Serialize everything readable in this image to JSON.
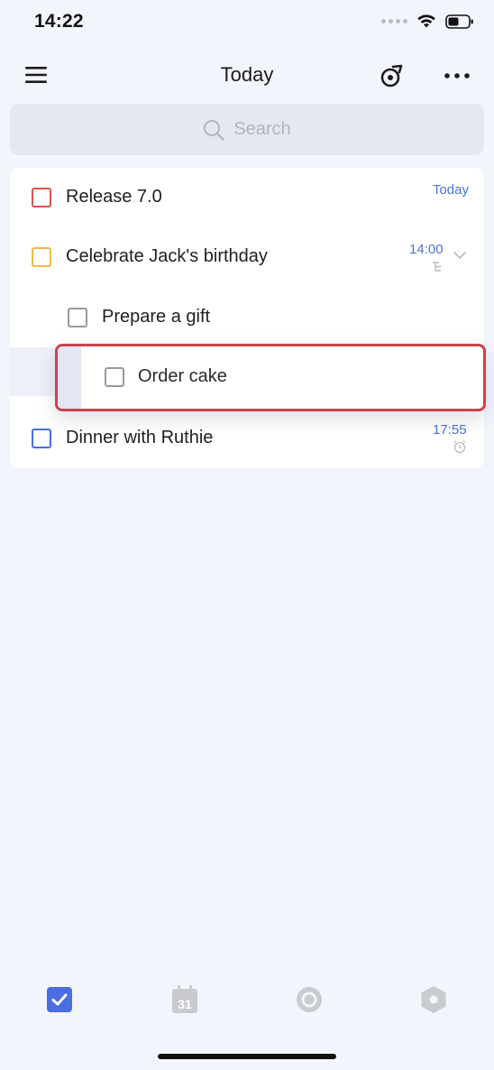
{
  "status_bar": {
    "time": "14:22"
  },
  "header": {
    "title": "Today"
  },
  "search": {
    "placeholder": "Search"
  },
  "tasks": [
    {
      "title": "Release 7.0",
      "date": "Today",
      "priority_color": "#d9534f"
    },
    {
      "title": "Celebrate Jack's birthday",
      "date": "14:00",
      "priority_color": "#f0b84a",
      "has_subtasks": true,
      "expanded": true
    },
    {
      "title": "Prepare a gift",
      "date": "",
      "priority_color": "#999999",
      "subtask": true
    },
    {
      "title": "Dinner with Ruthie",
      "date": "17:55",
      "priority_color": "#4a6ee0",
      "has_reminder": true
    }
  ],
  "dragged_task": {
    "title": "Order cake",
    "priority_color": "#999999"
  },
  "tab_bar": {
    "items": [
      {
        "icon": "checkbox-tab-icon",
        "active": true
      },
      {
        "icon": "calendar-tab-icon",
        "label": "31",
        "active": false
      },
      {
        "icon": "focus-tab-icon",
        "active": false
      },
      {
        "icon": "hexagon-tab-icon",
        "active": false
      }
    ]
  },
  "colors": {
    "accent": "#4a6ee0",
    "background": "#f3f5fd",
    "highlight_border": "#c8444a"
  }
}
